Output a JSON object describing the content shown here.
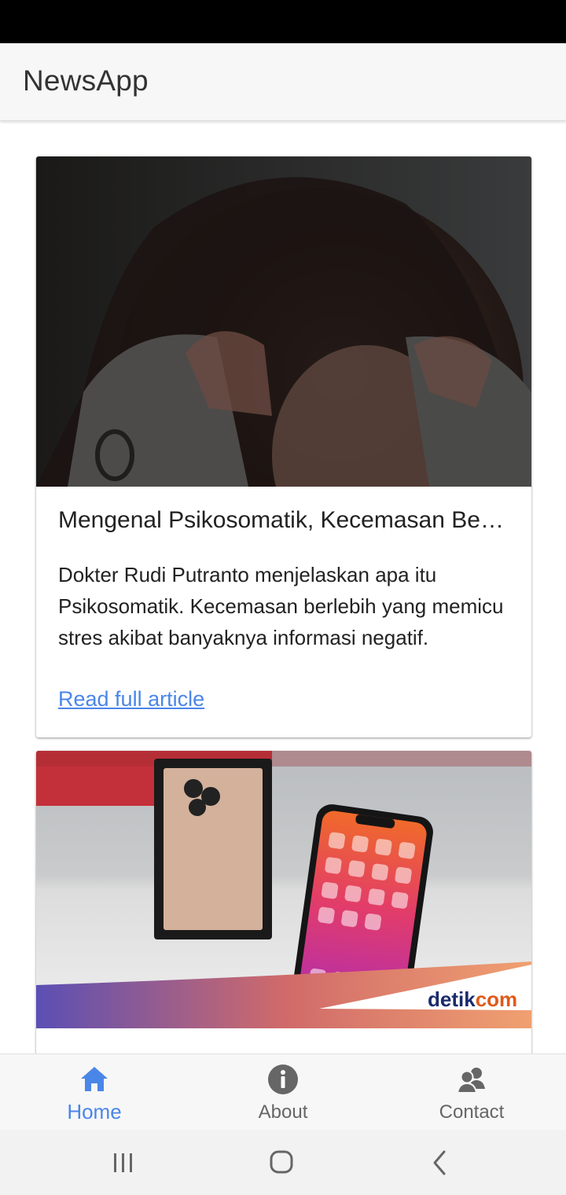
{
  "app": {
    "title": "NewsApp"
  },
  "articles": [
    {
      "title": "Mengenal Psikosomatik, Kecemasan Berlebih yang Memicu Stres",
      "description": "Dokter Rudi Putranto menjelaskan apa itu Psikosomatik. Kecemasan berlebih yang memicu stres akibat banyaknya informasi negatif.",
      "link_label": "Read full article",
      "image": "woman-holding-head-photo"
    },
    {
      "image": "iphone-box-photo",
      "image_logo": {
        "part1": "detik",
        "part2": "com"
      }
    }
  ],
  "bottom_nav": {
    "items": [
      {
        "label": "Home",
        "icon": "home-icon",
        "active": true
      },
      {
        "label": "About",
        "icon": "info-icon",
        "active": false
      },
      {
        "label": "Contact",
        "icon": "contact-icon",
        "active": false
      }
    ]
  },
  "colors": {
    "accent": "#4a86e8",
    "text": "#222222",
    "muted": "#666666",
    "app_bar": "#f7f7f7",
    "status_bar": "#000000"
  }
}
